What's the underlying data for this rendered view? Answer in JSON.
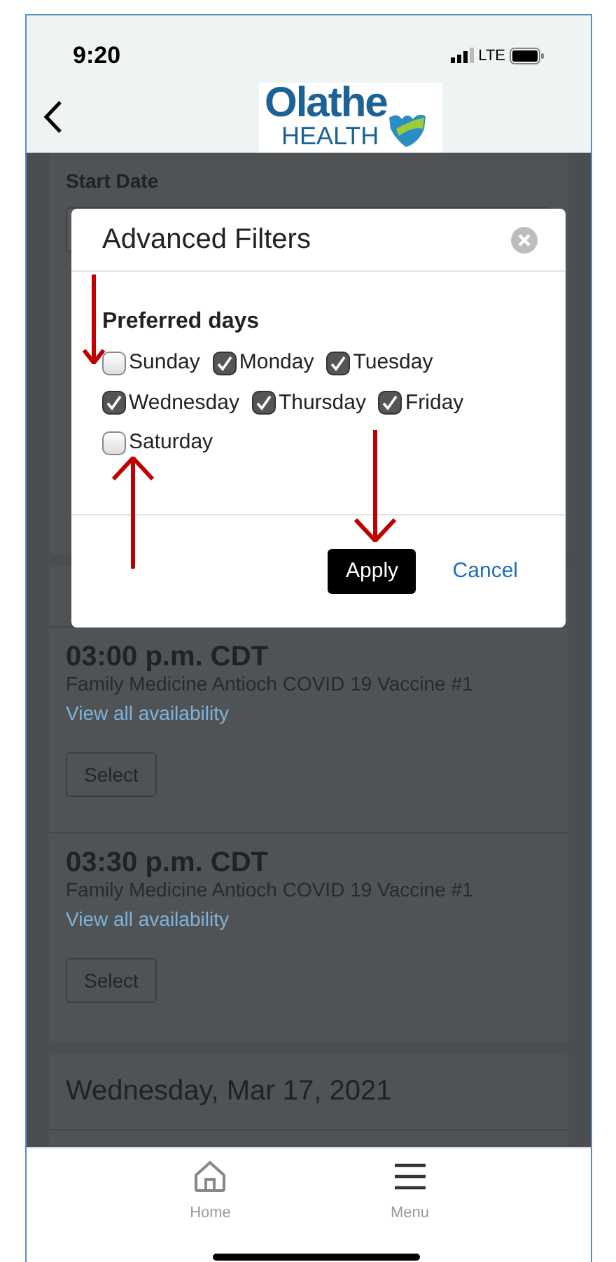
{
  "status_bar": {
    "time": "9:20",
    "network": "LTE"
  },
  "header": {
    "logo_top": "Olathe",
    "logo_bottom": "HEALTH"
  },
  "background": {
    "start_date_label": "Start Date",
    "slots": [
      {
        "time": "03:00 p.m. CDT",
        "location": "Family Medicine Antioch COVID 19 Vaccine #1",
        "link": "View all availability",
        "button": "Select"
      },
      {
        "time": "03:30 p.m. CDT",
        "location": "Family Medicine Antioch COVID 19 Vaccine #1",
        "link": "View all availability",
        "button": "Select"
      }
    ],
    "next_day": "Wednesday, Mar 17, 2021"
  },
  "dialog": {
    "title": "Advanced Filters",
    "section": "Preferred days",
    "days": [
      {
        "label": "Sunday",
        "checked": false
      },
      {
        "label": "Monday",
        "checked": true
      },
      {
        "label": "Tuesday",
        "checked": true
      },
      {
        "label": "Wednesday",
        "checked": true
      },
      {
        "label": "Thursday",
        "checked": true
      },
      {
        "label": "Friday",
        "checked": true
      },
      {
        "label": "Saturday",
        "checked": false
      }
    ],
    "apply": "Apply",
    "cancel": "Cancel"
  },
  "bottom_nav": [
    {
      "label": "Home",
      "kind": "home"
    },
    {
      "label": "Menu",
      "kind": "menu"
    }
  ]
}
